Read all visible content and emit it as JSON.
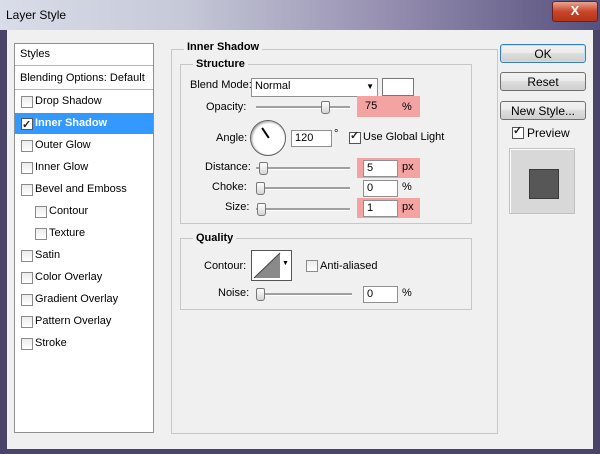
{
  "window": {
    "title": "Layer Style",
    "close_glyph": "X"
  },
  "styles_panel": {
    "header": "Styles",
    "blending": "Blending Options: Default",
    "items": [
      {
        "label": "Drop Shadow",
        "checked": false,
        "selected": false
      },
      {
        "label": "Inner Shadow",
        "checked": true,
        "selected": true
      },
      {
        "label": "Outer Glow",
        "checked": false,
        "selected": false
      },
      {
        "label": "Inner Glow",
        "checked": false,
        "selected": false
      },
      {
        "label": "Bevel and Emboss",
        "checked": false,
        "selected": false
      },
      {
        "label": "Contour",
        "checked": false,
        "selected": false
      },
      {
        "label": "Texture",
        "checked": false,
        "selected": false
      },
      {
        "label": "Satin",
        "checked": false,
        "selected": false
      },
      {
        "label": "Color Overlay",
        "checked": false,
        "selected": false
      },
      {
        "label": "Gradient Overlay",
        "checked": false,
        "selected": false
      },
      {
        "label": "Pattern Overlay",
        "checked": false,
        "selected": false
      },
      {
        "label": "Stroke",
        "checked": false,
        "selected": false
      }
    ]
  },
  "inner_shadow": {
    "title": "Inner Shadow",
    "structure": {
      "title": "Structure",
      "blend_mode_label": "Blend Mode:",
      "blend_mode_value": "Normal",
      "shadow_color": "#ffffff",
      "opacity_label": "Opacity:",
      "opacity_value": "75",
      "opacity_unit": "%",
      "opacity_level": 0.75,
      "angle_label": "Angle:",
      "angle_value": "120",
      "angle_unit": "°",
      "use_global_light_label": "Use Global Light",
      "use_global_light_checked": true,
      "distance_label": "Distance:",
      "distance_value": "5",
      "distance_unit": "px",
      "distance_level": 0.03,
      "choke_label": "Choke:",
      "choke_value": "0",
      "choke_unit": "%",
      "choke_level": 0,
      "size_label": "Size:",
      "size_value": "1",
      "size_unit": "px",
      "size_level": 0.01
    },
    "quality": {
      "title": "Quality",
      "contour_label": "Contour:",
      "anti_aliased_label": "Anti-aliased",
      "anti_aliased_checked": false,
      "noise_label": "Noise:",
      "noise_value": "0",
      "noise_unit": "%",
      "noise_level": 0
    }
  },
  "buttons": {
    "ok": "OK",
    "reset": "Reset",
    "new_style": "New Style...",
    "preview_label": "Preview",
    "preview_checked": true
  },
  "colors": {
    "selection": "#3399ff",
    "highlight": "#f4a3a3",
    "preview_swatch": "#575757"
  }
}
